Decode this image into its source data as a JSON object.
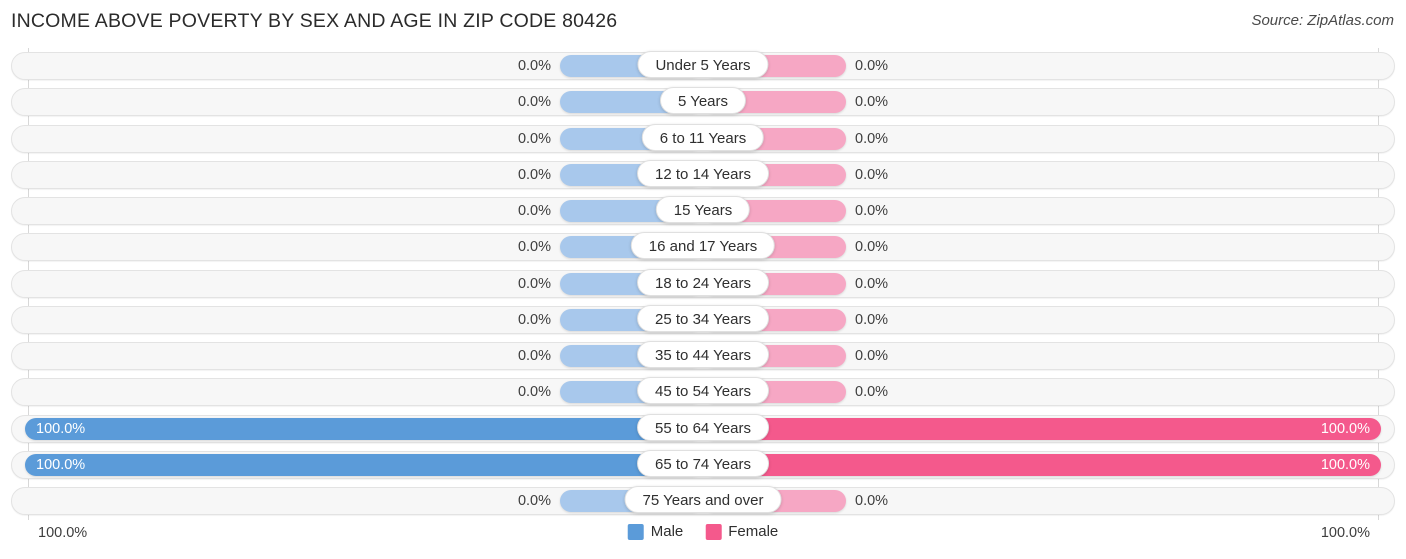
{
  "header": {
    "title": "INCOME ABOVE POVERTY BY SEX AND AGE IN ZIP CODE 80426",
    "source": "Source: ZipAtlas.com"
  },
  "legend": {
    "male": {
      "label": "Male",
      "color": "#5b9bd9"
    },
    "female": {
      "label": "Female",
      "color": "#f4598c"
    }
  },
  "axis": {
    "left_label": "100.0%",
    "right_label": "100.0%"
  },
  "colors": {
    "male_zero": "#a8c8ec",
    "female_zero": "#f6a7c4",
    "male_full": "#5b9bd9",
    "female_full": "#f4598c",
    "track": "#f7f7f7"
  },
  "chart_data": {
    "type": "bar",
    "title": "INCOME ABOVE POVERTY BY SEX AND AGE IN ZIP CODE 80426",
    "xlabel": "",
    "ylabel": "",
    "orientation": "horizontal-diverging",
    "xlim": [
      0,
      100
    ],
    "grid": true,
    "legend_position": "bottom-center",
    "categories": [
      "Under 5 Years",
      "5 Years",
      "6 to 11 Years",
      "12 to 14 Years",
      "15 Years",
      "16 and 17 Years",
      "18 to 24 Years",
      "25 to 34 Years",
      "35 to 44 Years",
      "45 to 54 Years",
      "55 to 64 Years",
      "65 to 74 Years",
      "75 Years and over"
    ],
    "series": [
      {
        "name": "Male",
        "values": [
          0.0,
          0.0,
          0.0,
          0.0,
          0.0,
          0.0,
          0.0,
          0.0,
          0.0,
          0.0,
          100.0,
          100.0,
          0.0
        ],
        "labels": [
          "0.0%",
          "0.0%",
          "0.0%",
          "0.0%",
          "0.0%",
          "0.0%",
          "0.0%",
          "0.0%",
          "0.0%",
          "0.0%",
          "100.0%",
          "100.0%",
          "0.0%"
        ]
      },
      {
        "name": "Female",
        "values": [
          0.0,
          0.0,
          0.0,
          0.0,
          0.0,
          0.0,
          0.0,
          0.0,
          0.0,
          0.0,
          100.0,
          100.0,
          0.0
        ],
        "labels": [
          "0.0%",
          "0.0%",
          "0.0%",
          "0.0%",
          "0.0%",
          "0.0%",
          "0.0%",
          "0.0%",
          "0.0%",
          "0.0%",
          "100.0%",
          "100.0%",
          "0.0%"
        ]
      }
    ]
  }
}
